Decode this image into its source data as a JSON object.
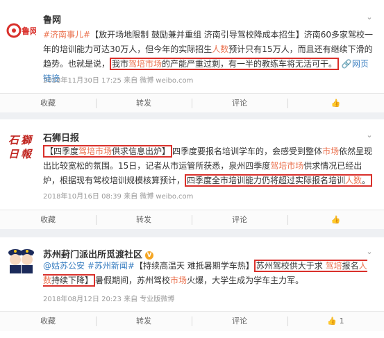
{
  "posts": [
    {
      "account": "鲁网",
      "logo_text": "鲁网",
      "text_parts": {
        "tag": "#济南事儿#",
        "p1": "【放开场地限制 鼓励兼并重组 济南引导驾校降成本招生】济南60多家驾校一年的培训能力可达30万人，但今年的实际招生",
        "h1": "人数",
        "p2": "预计只有15万人，而且还有继续下滑的趋势。也就是说，",
        "boxed_a": "我市",
        "boxed_h": "驾培市场",
        "boxed_b": "的产能严重过剩，有一半的教练车将无活可干。",
        "link": "网页链接"
      },
      "meta": "2018年11月30日 17:25 来自 微博 weibo.com",
      "actions": {
        "collect": "收藏",
        "repost": "转发",
        "comment": "评论",
        "like_count": ""
      }
    },
    {
      "account": "石狮日报",
      "logo_text": "石狮日报",
      "text_parts": {
        "box1_a": "【四季度",
        "box1_h": "驾培市场",
        "box1_b": "供求信息出炉】",
        "p1": "四季度要报名培训学车的，会感受到整体",
        "h1": "市场",
        "p2": "依然呈现出比较宽松的氛围。15日，记者从市运管所获悉，泉州四季度",
        "h2": "驾培市场",
        "p3": "供求情况已经出炉，根据现有驾校培训规模核算预计，",
        "boxed_a": "四季度全市培训能力仍将超过实际报名培训",
        "boxed_h": "人数",
        "boxed_b": "。"
      },
      "meta": "2018年10月16日 08:39 来自 微博 weibo.com",
      "actions": {
        "collect": "收藏",
        "repost": "转发",
        "comment": "评论",
        "like_count": ""
      }
    },
    {
      "account": "苏州葑门派出所觅渡社区",
      "text_parts": {
        "mention": "@姑苏公安",
        "tag": "#苏州新闻#",
        "p1": "【持续高温天 难抵暑期学车热】",
        "boxed_a": "苏州驾校供大于求 ",
        "boxed_h1": "驾培",
        "boxed_b": "报名",
        "boxed_h2": "人数",
        "boxed_c": "持续下降】",
        "p2": "暑假期间，苏州驾校",
        "h1": "市场",
        "p3": "火爆，大学生成为学车主力军。"
      },
      "meta": "2018年08月12日 20:23 来自 专业版微博",
      "actions": {
        "collect": "收藏",
        "repost": "转发",
        "comment": "评论",
        "like_count": "1"
      }
    }
  ],
  "colors": {
    "highlight": "#eb7350",
    "box": "#d9302b",
    "link": "#3a7fc1",
    "badge": "#f5a623"
  }
}
